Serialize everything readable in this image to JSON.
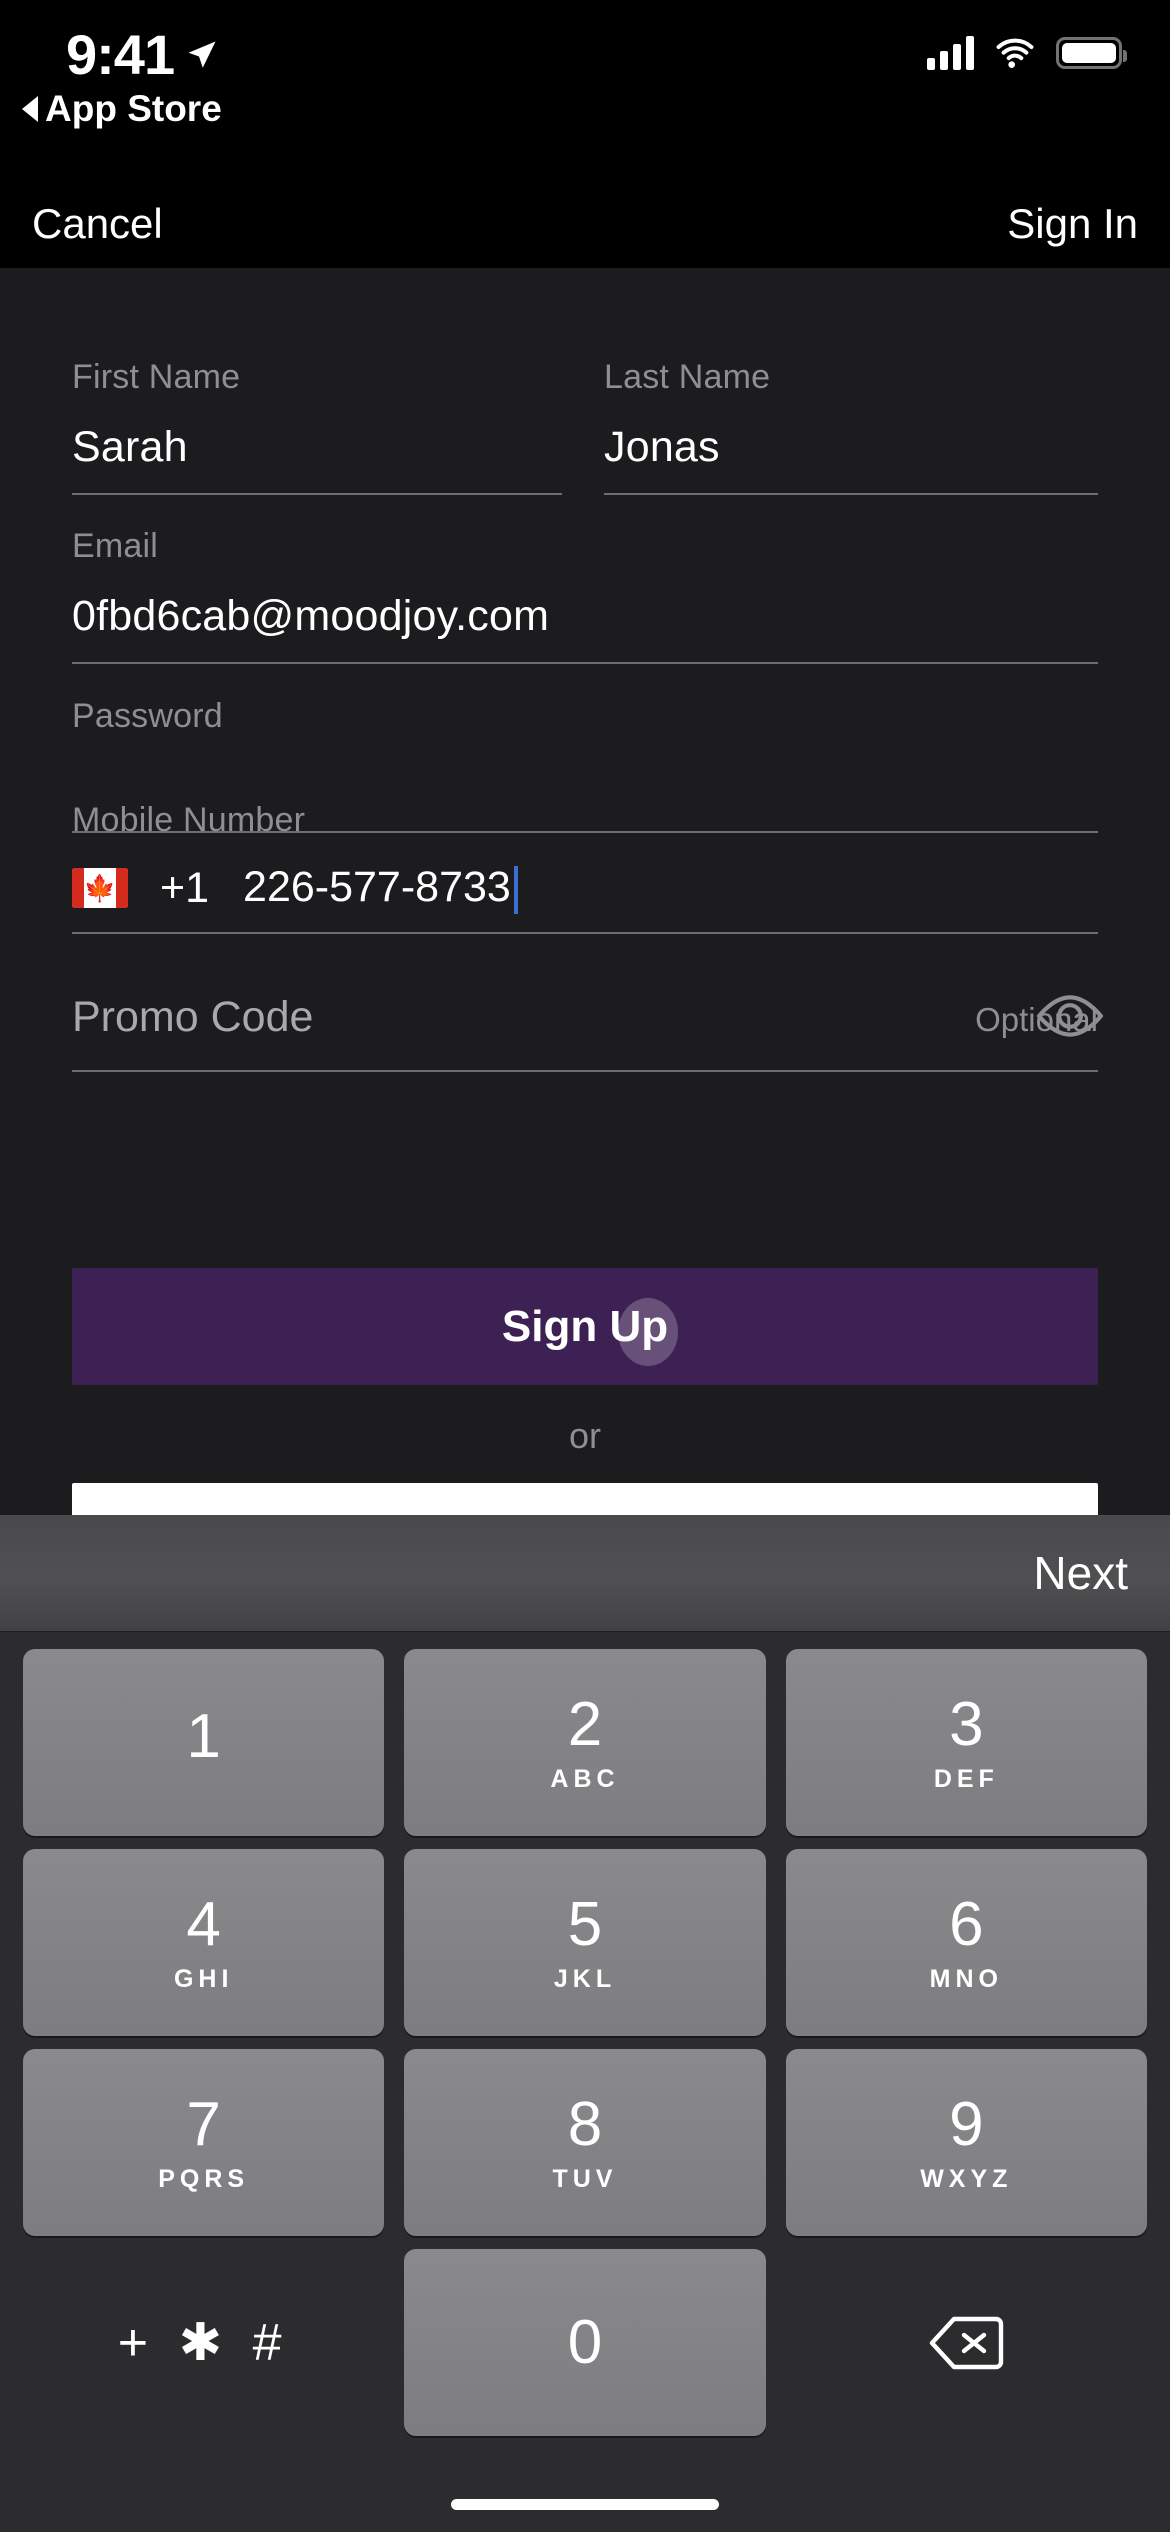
{
  "status_bar": {
    "time": "9:41",
    "back_app_label": "App Store",
    "location_icon": "location-arrow-icon",
    "signal_icon": "cellular-signal-icon",
    "wifi_icon": "wifi-icon",
    "battery_icon": "battery-icon"
  },
  "nav_bar": {
    "cancel_label": "Cancel",
    "signin_label": "Sign In"
  },
  "form": {
    "first_name": {
      "label": "First Name",
      "value": "Sarah"
    },
    "last_name": {
      "label": "Last Name",
      "value": "Jonas"
    },
    "email": {
      "label": "Email",
      "value": "0fbd6cab@moodjoy.com"
    },
    "password": {
      "label": "Password",
      "value": "",
      "toggle_icon": "eye-icon"
    },
    "mobile": {
      "label": "Mobile Number",
      "country_flag": "canada-flag-icon",
      "country_code": "+1",
      "number": "226-577-8733"
    },
    "promo": {
      "placeholder": "Promo Code",
      "optional_label": "Optional"
    }
  },
  "actions": {
    "signup_label": "Sign Up",
    "or_label": "or",
    "signup_color": "#3d2154"
  },
  "keyboard": {
    "toolbar": {
      "next_label": "Next"
    },
    "rows": [
      [
        {
          "num": "1",
          "letters": ""
        },
        {
          "num": "2",
          "letters": "ABC"
        },
        {
          "num": "3",
          "letters": "DEF"
        }
      ],
      [
        {
          "num": "4",
          "letters": "GHI"
        },
        {
          "num": "5",
          "letters": "JKL"
        },
        {
          "num": "6",
          "letters": "MNO"
        }
      ],
      [
        {
          "num": "7",
          "letters": "PQRS"
        },
        {
          "num": "8",
          "letters": "TUV"
        },
        {
          "num": "9",
          "letters": "WXYZ"
        }
      ]
    ],
    "bottom": {
      "symbols": "+ ✱ #",
      "zero": "0",
      "delete_icon": "backspace-icon"
    }
  }
}
